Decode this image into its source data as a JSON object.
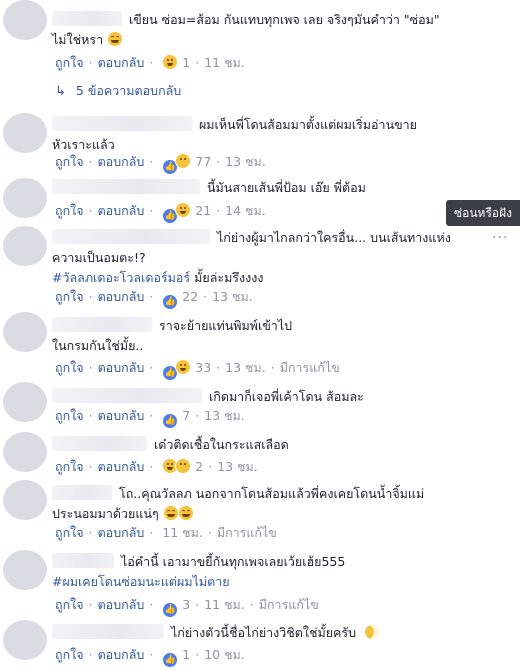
{
  "actions": {
    "like": "ถูกใจ",
    "reply": "ตอบกลับ",
    "separator": "·"
  },
  "comments": [
    {
      "text": "เขียน ซ่อม=ส้อม กันแทบทุกเพจ เลย จริงๆมันคำว่า \"ซ่อม\" ไม่ใช่หรา",
      "reaction_count": "1",
      "time": "11 ชม.",
      "reactions": [
        "haha"
      ],
      "replies_label": "5 ข้อความตอบกลับ"
    },
    {
      "text": "ผมเห็นพี่โดนส้อมมาตั้งแต่ผมเริ่มอ่านขายหัวเราะแล้ว",
      "reaction_count": "77",
      "time": "13 ชม.",
      "reactions": [
        "like",
        "haha"
      ]
    },
    {
      "text": "นี้มันสายเส้นพี่ป้อม เอ๊ย พี่ต้อม",
      "reaction_count": "21",
      "time": "14 ชม.",
      "reactions": [
        "like",
        "haha"
      ]
    },
    {
      "text": "ไก่ย่างผู้มาไกลกว่าใครอื่น... บนเส้นทางแห่งความเป็นอมตะ!?",
      "tag": "#วัลลภเดอะโวลเดอร์มอร์",
      "tag_suffix": "มั้ยล่ะมรึงงงง",
      "reaction_count": "22",
      "time": "13 ชม.",
      "reactions": [
        "like"
      ]
    },
    {
      "text": "ราจะย้ายแท่นพิมพ์เข้าไปในกรมกันใช่มั้ย..",
      "reaction_count": "33",
      "time": "13 ชม.",
      "edited": "มีการแก้ไข",
      "reactions": [
        "like",
        "haha"
      ]
    },
    {
      "text": "เกิดมาก็เจอพี่เค้าโดน ส้อมละ",
      "reaction_count": "7",
      "time": "13 ชม.",
      "reactions": [
        "like"
      ]
    },
    {
      "text": "เด๋วติดเชื้อในกระแสเลือด",
      "reaction_count": "2",
      "time": "13 ชม.",
      "reactions": [
        "haha",
        "wow"
      ]
    },
    {
      "text": "โถ..คุณวัลลภ นอกจากโดนส้อมแล้วพี่คงเคยโดนน้ำจิ้มแม่ประนอมมาด้วยแน่ๆ",
      "reaction_count": "",
      "time": "11 ชม.",
      "edited": "มีการแก้ไข",
      "reactions": []
    },
    {
      "text": "ไอ่คำนี้ เอามาขยี้กันทุกเพจเลยเว้ยเฮ้ย555",
      "tag": "#ผมเคยโดนซ่อมนะแต่ผมไม่ตาย",
      "reaction_count": "3",
      "time": "11 ชม.",
      "edited": "มีการแก้ไข",
      "reactions": [
        "like"
      ]
    },
    {
      "text": "ไก่ย่างตัวนี้ชื่อไก่ย่างวิชิตใช่มั้ยครับ",
      "reaction_count": "1",
      "time": "10 ชม.",
      "reactions": [
        "like"
      ]
    }
  ],
  "tooltip": "ซ่อนหรือฝัง",
  "more_icon": "more-dots-icon"
}
